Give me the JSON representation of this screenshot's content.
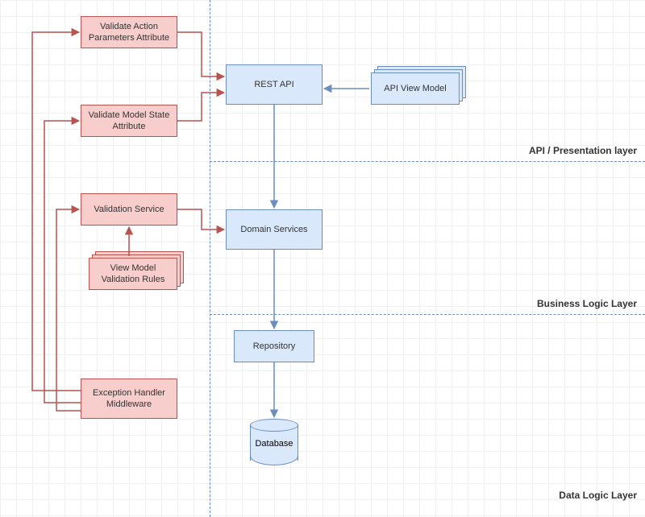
{
  "boxes": {
    "validate_action": "Validate Action\nParameters Attribute",
    "validate_model_state": "Validate Model State\nAttribute",
    "validation_service": "Validation Service",
    "view_model_rules": "View Model\nValidation Rules",
    "exception_handler": "Exception Handler\nMiddleware",
    "rest_api": "REST API",
    "api_view_model": "API View Model",
    "domain_services": "Domain Services",
    "repository": "Repository",
    "database": "Database"
  },
  "layers": {
    "api": "API / Presentation layer",
    "business": "Business Logic Layer",
    "data": "Data Logic Layer"
  },
  "colors": {
    "pink_fill": "#f8cecc",
    "pink_border": "#b85450",
    "blue_fill": "#dae8fc",
    "blue_border": "#6c8ebf"
  }
}
